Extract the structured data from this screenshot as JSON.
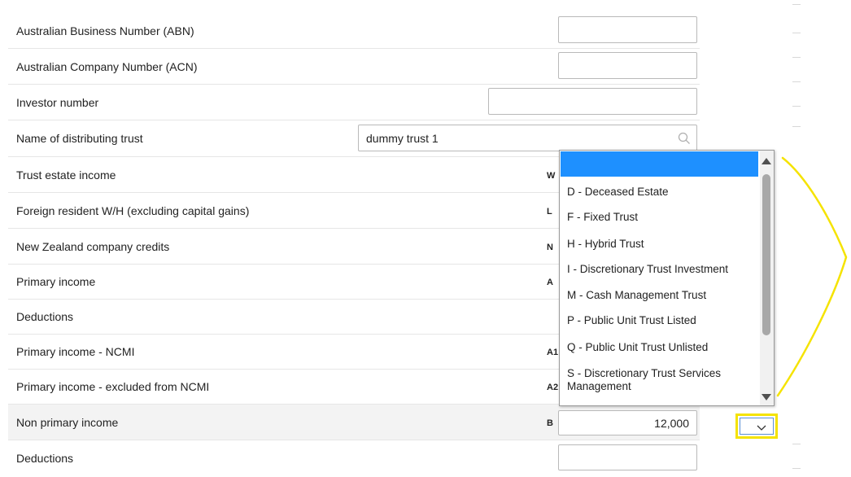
{
  "rows": [
    {
      "label": "Australian Business Number (ABN)",
      "code": "",
      "value": ""
    },
    {
      "label": "Australian Company Number (ACN)",
      "code": "",
      "value": ""
    },
    {
      "label": "Investor number",
      "code": "",
      "value": ""
    },
    {
      "label": "Name of distributing trust",
      "code": "",
      "value": "dummy trust 1"
    },
    {
      "label": "Trust estate income",
      "code": "W",
      "value": ""
    },
    {
      "label": "Foreign resident W/H (excluding capital gains)",
      "code": "L",
      "value": ""
    },
    {
      "label": "New Zealand company credits",
      "code": "N",
      "value": ""
    },
    {
      "label": "Primary income",
      "code": "A",
      "value": ""
    },
    {
      "label": "Deductions",
      "code": "",
      "value": ""
    },
    {
      "label": "Primary income - NCMI",
      "code": "A1",
      "value": ""
    },
    {
      "label": "Primary income - excluded from NCMI",
      "code": "A2",
      "value": ""
    },
    {
      "label": "Non primary income",
      "code": "B",
      "value": "12,000"
    },
    {
      "label": "Deductions",
      "code": "",
      "value": ""
    }
  ],
  "dropdown": {
    "options": [
      {
        "label": ""
      },
      {
        "label": "D - Deceased Estate"
      },
      {
        "label": "F - Fixed Trust"
      },
      {
        "label": "H - Hybrid Trust"
      },
      {
        "label": "I - Discretionary Trust Investment"
      },
      {
        "label": "M - Cash Management Trust"
      },
      {
        "label": "P - Public Unit Trust Listed"
      },
      {
        "label": "Q - Public Unit Trust Unlisted"
      },
      {
        "label": "S - Discretionary Trust Services Management"
      }
    ],
    "selected_value": ""
  },
  "colors": {
    "selected_option": "#1e90ff",
    "annotation": "#f5e300"
  },
  "icons": {
    "search": "search-icon",
    "select_chevron": "chevron-down-icon"
  }
}
